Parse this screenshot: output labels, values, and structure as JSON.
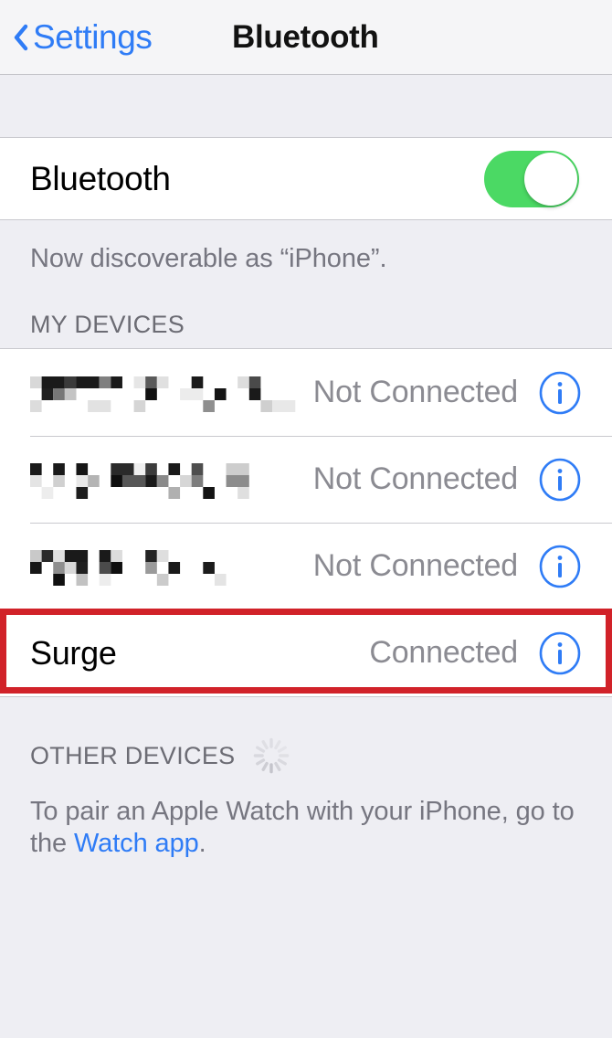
{
  "navbar": {
    "back_label": "Settings",
    "back_icon": "chevron-left-icon",
    "title": "Bluetooth"
  },
  "bluetooth_toggle": {
    "label": "Bluetooth",
    "state": "on",
    "on_color": "#4bd964"
  },
  "discoverable_caption": "Now discoverable as “iPhone”.",
  "my_devices": {
    "header": "MY DEVICES",
    "rows": [
      {
        "name": "",
        "redacted": true,
        "status": "Not Connected",
        "info_icon": "info-circle-icon",
        "highlighted": false
      },
      {
        "name": "",
        "redacted": true,
        "status": "Not Connected",
        "info_icon": "info-circle-icon",
        "highlighted": false
      },
      {
        "name": "",
        "redacted": true,
        "status": "Not Connected",
        "info_icon": "info-circle-icon",
        "highlighted": false
      },
      {
        "name": "Surge",
        "redacted": false,
        "status": "Connected",
        "info_icon": "info-circle-icon",
        "highlighted": true
      }
    ]
  },
  "other_devices": {
    "header": "OTHER DEVICES",
    "spinner_icon": "activity-spinner-icon"
  },
  "footer": {
    "text_before": "To pair an Apple Watch with your iPhone, go to the ",
    "link_label": "Watch app",
    "text_after": "."
  },
  "annotation": {
    "color": "#d12229",
    "target_row": "Surge"
  }
}
